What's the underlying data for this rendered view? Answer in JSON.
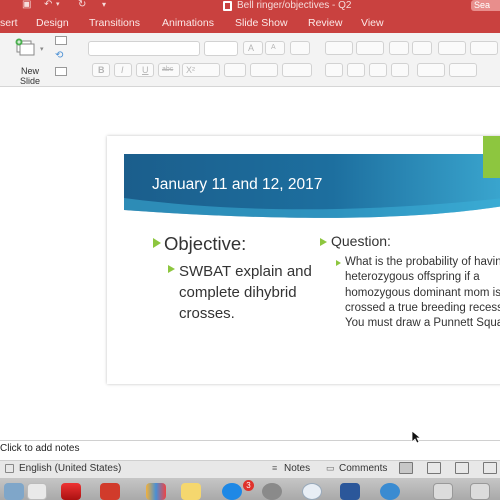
{
  "window": {
    "title": "Bell ringer/objectives - Q2",
    "search_placeholder": "Sea"
  },
  "tabs": [
    {
      "label": "sert"
    },
    {
      "label": "Design"
    },
    {
      "label": "Transitions"
    },
    {
      "label": "Animations"
    },
    {
      "label": "Slide Show"
    },
    {
      "label": "Review"
    },
    {
      "label": "View"
    }
  ],
  "toolbar": {
    "new_slide_label": "New Slide",
    "bold": "B",
    "italic": "I",
    "underline": "U",
    "strikethrough": "abc",
    "superscript": "X²",
    "font_grow": "A",
    "font_shrink": "A"
  },
  "slide": {
    "title": "January 11 and 12, 2017",
    "objective_heading": "Objective:",
    "objective_body": "SWBAT explain and complete dihybrid crosses.",
    "question_heading": "Question:",
    "question_body": "What is the probability of having a heterozygous offspring if a homozygous dominant mom is crossed a true breeding recessive You must draw a Punnett Square.",
    "accent_color": "#8dc63f",
    "banner_color": "#1b5e8c"
  },
  "notes": {
    "placeholder": "Click to add notes"
  },
  "status_bar": {
    "language": "English (United States)",
    "notes_label": "Notes",
    "comments_label": "Comments"
  },
  "dock": {
    "appstore_badge": "3"
  },
  "colors": {
    "ribbon": "#c9413f",
    "toolbar": "#f3f3f3"
  }
}
